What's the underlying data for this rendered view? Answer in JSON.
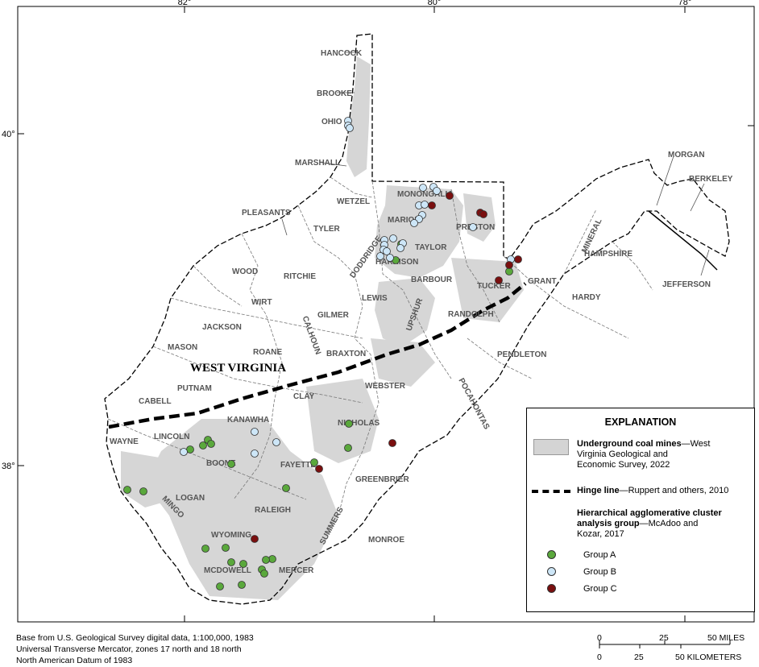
{
  "map": {
    "state_label": "WEST VIRGINIA",
    "lon_ticks": [
      "82°",
      "80°",
      "78°"
    ],
    "lat_ticks": [
      "40°",
      "38°"
    ],
    "counties": [
      "HANCOCK",
      "BROOKE",
      "OHIO",
      "MARSHALL",
      "WETZEL",
      "MONONGALIA",
      "PLEASANTS",
      "TYLER",
      "MARION",
      "PRESTON",
      "MORGAN",
      "BERKELEY",
      "MINERAL",
      "HAMPSHIRE",
      "JEFFERSON",
      "DODDRIDGE",
      "TAYLOR",
      "HARRISON",
      "WOOD",
      "RITCHIE",
      "BARBOUR",
      "TUCKER",
      "GRANT",
      "HARDY",
      "WIRT",
      "LEWIS",
      "GILMER",
      "JACKSON",
      "CALHOUN",
      "UPSHUR",
      "RANDOLPH",
      "MASON",
      "ROANE",
      "BRAXTON",
      "PENDLETON",
      "CABELL",
      "PUTNAM",
      "CLAY",
      "WEBSTER",
      "KANAWHA",
      "NICHOLAS",
      "POCAHONTAS",
      "WAYNE",
      "LINCOLN",
      "BOONE",
      "FAYETTE",
      "GREENBRIER",
      "LOGAN",
      "RALEIGH",
      "MINGO",
      "SUMMERS",
      "MONROE",
      "WYOMING",
      "MCDOWELL",
      "MERCER"
    ]
  },
  "legend": {
    "title": "EXPLANATION",
    "mines_bold": "Underground coal mines",
    "mines_rest": "—West",
    "mines_line2": "Virginia Geological and",
    "mines_line3": "Economic Survey, 2022",
    "hinge_bold": "Hinge line",
    "hinge_rest": "—Ruppert and others, 2010",
    "cluster_line1": "Hierarchical agglomerative cluster",
    "cluster_bold2": "analysis group",
    "cluster_rest2": "—McAdoo and",
    "cluster_line3": "Kozar, 2017",
    "groups": [
      {
        "label": "Group A",
        "color": "#5aa83c"
      },
      {
        "label": "Group B",
        "color": "#cde6f7"
      },
      {
        "label": "Group C",
        "color": "#7a0f0f"
      }
    ]
  },
  "credits": [
    "Base from U.S. Geological Survey digital data, 1:100,000, 1983",
    "Universal Transverse Mercator, zones 17 north and 18 north",
    "North American Datum of 1983"
  ],
  "scale": {
    "miles": [
      "0",
      "25",
      "50 MILES"
    ],
    "km": [
      "0",
      "25",
      "50 KILOMETERS"
    ]
  },
  "samples": {
    "groupA": [
      [
        491,
        323
      ],
      [
        498,
        303
      ],
      [
        632,
        337
      ],
      [
        258,
        546
      ],
      [
        262,
        551
      ],
      [
        252,
        553
      ],
      [
        236,
        558
      ],
      [
        287,
        576
      ],
      [
        433,
        526
      ],
      [
        432,
        556
      ],
      [
        390,
        574
      ],
      [
        355,
        606
      ],
      [
        158,
        608
      ],
      [
        178,
        610
      ],
      [
        255,
        681
      ],
      [
        280,
        680
      ],
      [
        338,
        694
      ],
      [
        330,
        695
      ],
      [
        287,
        698
      ],
      [
        302,
        700
      ],
      [
        325,
        707
      ],
      [
        328,
        712
      ],
      [
        273,
        728
      ],
      [
        300,
        726
      ]
    ],
    "groupB": [
      [
        432,
        150
      ],
      [
        432,
        156
      ],
      [
        434,
        159
      ],
      [
        525,
        233
      ],
      [
        538,
        232
      ],
      [
        542,
        237
      ],
      [
        520,
        255
      ],
      [
        527,
        254
      ],
      [
        524,
        267
      ],
      [
        520,
        272
      ],
      [
        514,
        277
      ],
      [
        500,
        302
      ],
      [
        488,
        296
      ],
      [
        477,
        298
      ],
      [
        477,
        304
      ],
      [
        476,
        310
      ],
      [
        472,
        318
      ],
      [
        480,
        312
      ],
      [
        484,
        320
      ],
      [
        497,
        308
      ],
      [
        587,
        282
      ],
      [
        634,
        322
      ],
      [
        316,
        536
      ],
      [
        343,
        549
      ],
      [
        228,
        561
      ],
      [
        316,
        563
      ]
    ],
    "groupC": [
      [
        558,
        243
      ],
      [
        536,
        255
      ],
      [
        596,
        264
      ],
      [
        600,
        266
      ],
      [
        643,
        322
      ],
      [
        632,
        329
      ],
      [
        619,
        348
      ],
      [
        487,
        550
      ],
      [
        396,
        582
      ],
      [
        316,
        669
      ]
    ]
  }
}
